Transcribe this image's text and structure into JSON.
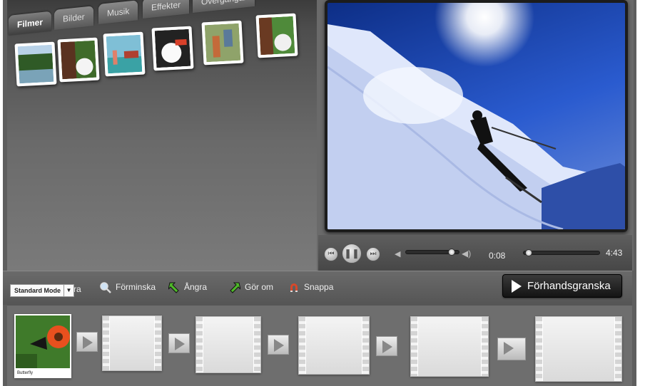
{
  "library": {
    "tabs": [
      "Filmer",
      "Bilder",
      "Musik",
      "Effekter",
      "Övergångar"
    ],
    "active_tab": "Filmer"
  },
  "player": {
    "current_time": "0:08",
    "total_time": "4:43",
    "volume_level": 0.85,
    "progress_fraction": 0.03
  },
  "toolbar": {
    "mode": "Standard Mode",
    "zoom_in_label": "ra",
    "zoom_out_label": "Förminska",
    "undo_label": "Ångra",
    "redo_label": "Gör om",
    "snap_label": "Snappa",
    "preview_label": "Förhandsgranska"
  },
  "timeline": {
    "first_clip_label": "Butterfly"
  },
  "colors": {
    "panel": "#6a6a6a",
    "dark": "#141414",
    "sky": "#2a5bcf"
  }
}
